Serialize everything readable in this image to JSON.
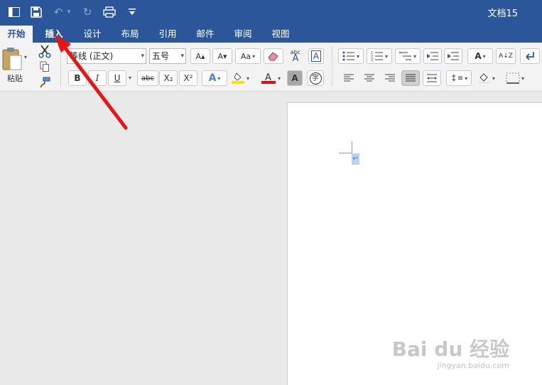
{
  "window": {
    "title": "文档15"
  },
  "quick_access": {
    "icons": [
      "sidebar-icon",
      "save-icon",
      "undo-icon",
      "redo-icon",
      "print-icon",
      "customize-icon"
    ],
    "undo_glyph": "↶",
    "redo_glyph": "↻",
    "print_glyph": "⎙",
    "customize_glyph": "⌄"
  },
  "tabs": [
    {
      "label": "开始",
      "active": true
    },
    {
      "label": "插入"
    },
    {
      "label": "设计"
    },
    {
      "label": "布局"
    },
    {
      "label": "引用"
    },
    {
      "label": "邮件"
    },
    {
      "label": "审阅"
    },
    {
      "label": "视图"
    }
  ],
  "clipboard": {
    "paste_label": "粘贴",
    "tooltip": "粘贴"
  },
  "font": {
    "name": "等线 (正文)",
    "size": "五号",
    "grow": "A▴",
    "shrink": "A▾",
    "change_case": "Aa",
    "bold": "B",
    "italic": "I",
    "underline": "U",
    "strikethrough": "abc",
    "subscript": "X₂",
    "superscript": "X²",
    "effects": "A",
    "highlight_color": "#f5e500",
    "font_color": "#e01010",
    "char_shading": "A",
    "enclose": "字",
    "phonetic_top": "abc",
    "phonetic_bottom": "A",
    "border_char": "A"
  },
  "paragraph": {
    "sort": "A↓Z",
    "line_spacing": "↕"
  },
  "document": {
    "paragraph_mark": "↵"
  },
  "watermark": {
    "brand": "Bai du 经验",
    "url": "jingyan.baidu.com"
  },
  "colors": {
    "brand": "#2b579a",
    "annotation_arrow": "#e81515"
  }
}
